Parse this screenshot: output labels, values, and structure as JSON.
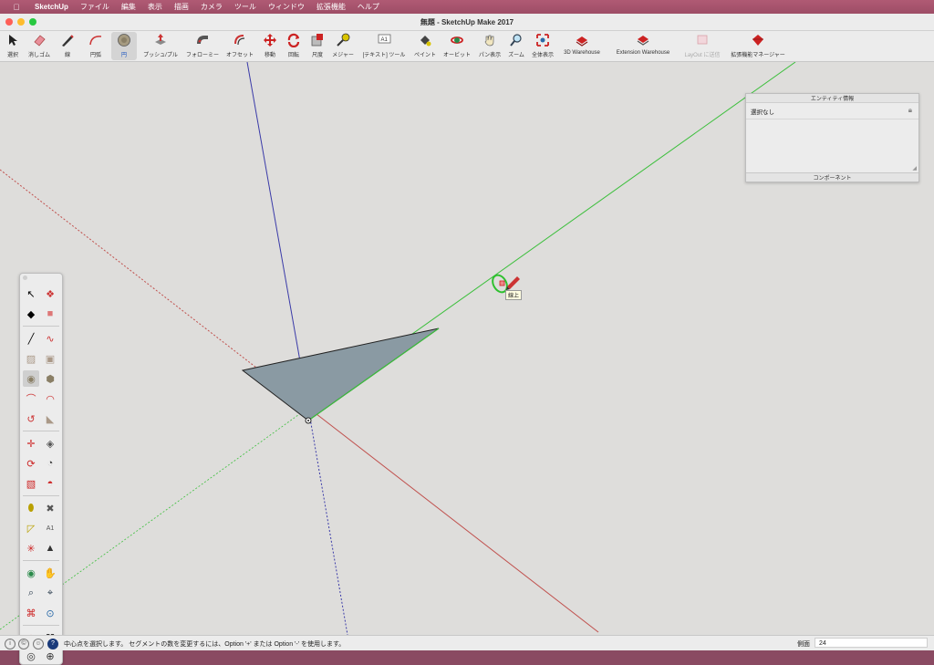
{
  "menubar": {
    "apple_icon": "apple-icon",
    "app_name": "SketchUp",
    "items": [
      "ファイル",
      "編集",
      "表示",
      "描画",
      "カメラ",
      "ツール",
      "ウィンドウ",
      "拡張機能",
      "ヘルプ"
    ]
  },
  "window": {
    "title": "無題 - SketchUp Make 2017"
  },
  "toolbar": {
    "items": [
      {
        "label": "選択",
        "icon": "select-arrow-icon"
      },
      {
        "label": "消しゴム",
        "icon": "eraser-icon"
      },
      {
        "label": "線",
        "icon": "pencil-icon"
      },
      {
        "label": "円弧",
        "icon": "arc-icon"
      },
      {
        "label": "円",
        "icon": "circle-icon"
      },
      {
        "label": "プッシュ/プル",
        "icon": "push-pull-icon"
      },
      {
        "label": "フォローミー",
        "icon": "follow-me-icon"
      },
      {
        "label": "オフセット",
        "icon": "offset-icon"
      },
      {
        "label": "移動",
        "icon": "move-icon"
      },
      {
        "label": "回転",
        "icon": "rotate-icon"
      },
      {
        "label": "尺度",
        "icon": "scale-icon"
      },
      {
        "label": "メジャー",
        "icon": "tape-measure-icon"
      },
      {
        "label": "[テキスト] ツール",
        "icon": "text-icon"
      },
      {
        "label": "ペイント",
        "icon": "paint-bucket-icon"
      },
      {
        "label": "オービット",
        "icon": "orbit-icon"
      },
      {
        "label": "パン表示",
        "icon": "pan-hand-icon"
      },
      {
        "label": "ズーム",
        "icon": "zoom-icon"
      },
      {
        "label": "全体表示",
        "icon": "zoom-extents-icon"
      },
      {
        "label": "3D Warehouse",
        "icon": "warehouse-icon"
      },
      {
        "label": "Extension Warehouse",
        "icon": "extension-warehouse-icon"
      },
      {
        "label": "LayOut に送信",
        "icon": "layout-icon"
      },
      {
        "label": "拡張機能マネージャー",
        "icon": "extension-manager-icon"
      }
    ]
  },
  "entity_info": {
    "title": "エンティティ情報",
    "selection": "選択なし",
    "footer": "コンポーネント"
  },
  "tooltip": "線上",
  "statusbar": {
    "message": "中心点を選択します。 セグメントの数を変更するには、Option '+' または Option '-' を使用します。",
    "vcb_label": "側面",
    "vcb_value": "24"
  },
  "colors": {
    "menubar": "#9d4d66",
    "face": "#8a9aa3",
    "red_axis": "#c0504d",
    "green_axis": "#3cbf3c",
    "blue_axis": "#3a3aa8"
  }
}
